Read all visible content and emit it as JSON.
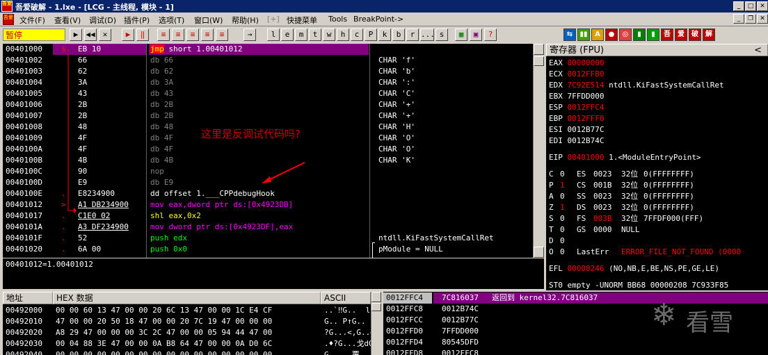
{
  "title": "吾爱破解 - 1.lxe - [LCG - 主线程, 模块 - 1]",
  "logo_text": "吾爱",
  "menu": [
    "文件(F)",
    "查看(V)",
    "调试(D)",
    "插件(P)",
    "选项(T)",
    "窗口(W)",
    "帮助(H)",
    "[+]",
    "快捷菜单",
    "Tools",
    "BreakPoint->"
  ],
  "status": "暂停",
  "toolbar_left": [
    "▶",
    "◀◀",
    "✕",
    "▶",
    "‖",
    "≡",
    "≡",
    "≡",
    "≡",
    "≡",
    "▶",
    "→"
  ],
  "toolbar_letters": [
    "l",
    "e",
    "m",
    "t",
    "w",
    "h",
    "c",
    "P",
    "k",
    "b",
    "r",
    "...",
    "s"
  ],
  "toolbar_right": [
    "⇆",
    "▮▮",
    "A",
    "●",
    "◎",
    "▮",
    "▮",
    "吾",
    "爱",
    "破",
    "解"
  ],
  "disasm": [
    {
      "addr": "00401000",
      "mark": "$.",
      "hex": "EB 10",
      "asm": "jmp short 1.00401012",
      "com": "",
      "sel": true
    },
    {
      "addr": "00401002",
      "mark": "",
      "hex": "66",
      "asm": "db 66",
      "com": "CHAR 'f'"
    },
    {
      "addr": "00401003",
      "mark": "",
      "hex": "62",
      "asm": "db 62",
      "com": "CHAR 'b'"
    },
    {
      "addr": "00401004",
      "mark": "",
      "hex": "3A",
      "asm": "db 3A",
      "com": "CHAR ':'"
    },
    {
      "addr": "00401005",
      "mark": "",
      "hex": "43",
      "asm": "db 43",
      "com": "CHAR 'C'"
    },
    {
      "addr": "00401006",
      "mark": "",
      "hex": "2B",
      "asm": "db 2B",
      "com": "CHAR '+'"
    },
    {
      "addr": "00401007",
      "mark": "",
      "hex": "2B",
      "asm": "db 2B",
      "com": "CHAR '+'"
    },
    {
      "addr": "00401008",
      "mark": "",
      "hex": "48",
      "asm": "db 48",
      "com": "CHAR 'H'"
    },
    {
      "addr": "00401009",
      "mark": "",
      "hex": "4F",
      "asm": "db 4F",
      "com": "CHAR 'O'"
    },
    {
      "addr": "0040100A",
      "mark": "",
      "hex": "4F",
      "asm": "db 4F",
      "com": "CHAR 'O'"
    },
    {
      "addr": "0040100B",
      "mark": "",
      "hex": "4B",
      "asm": "db 4B",
      "com": "CHAR 'K'"
    },
    {
      "addr": "0040100C",
      "mark": "",
      "hex": "90",
      "asm": "nop",
      "com": ""
    },
    {
      "addr": "0040100D",
      "mark": "",
      "hex": "E9",
      "asm": "db E9",
      "com": ""
    },
    {
      "addr": "0040100E",
      "mark": ".",
      "hex": "E8234900",
      "asm": "dd offset 1.___CPPdebugHook",
      "com": ""
    },
    {
      "addr": "00401012",
      "mark": ">",
      "hex": "A1 DB234900",
      "asm": "mov eax,dword ptr ds:[0x4923DB]",
      "com": ""
    },
    {
      "addr": "00401017",
      "mark": ".",
      "hex": "C1E0 02",
      "asm": "shl eax,0x2",
      "com": ""
    },
    {
      "addr": "0040101A",
      "mark": ".",
      "hex": "A3 DF234900",
      "asm": "mov dword ptr ds:[0x4923DF],eax",
      "com": ""
    },
    {
      "addr": "0040101F",
      "mark": ".",
      "hex": "52",
      "asm": "push edx",
      "com": "ntdll.KiFastSystemCallRet"
    },
    {
      "addr": "00401020",
      "mark": ".",
      "hex": "6A 00",
      "asm": "push 0x0",
      "com": "pModule = NULL"
    }
  ],
  "info_line": "00401012=1.00401012",
  "annotation": "这里是反调试代码吗?",
  "registers": {
    "header": "寄存器 (FPU)",
    "collapse": "<",
    "gp": [
      {
        "name": "EAX",
        "val": "00000000",
        "red": true,
        "com": ""
      },
      {
        "name": "ECX",
        "val": "0012FFB0",
        "red": true,
        "com": ""
      },
      {
        "name": "EDX",
        "val": "7C92E514",
        "red": true,
        "com": "ntdll.KiFastSystemCallRet"
      },
      {
        "name": "EBX",
        "val": "7FFDD000",
        "red": false,
        "com": ""
      },
      {
        "name": "ESP",
        "val": "0012FFC4",
        "red": true,
        "com": ""
      },
      {
        "name": "EBP",
        "val": "0012FFF0",
        "red": true,
        "com": ""
      },
      {
        "name": "ESI",
        "val": "0012B77C",
        "red": false,
        "com": ""
      },
      {
        "name": "EDI",
        "val": "0012B74C",
        "red": false,
        "com": ""
      }
    ],
    "eip": {
      "name": "EIP",
      "val": "00401000",
      "com": "1.<ModuleEntryPoint>"
    },
    "flags": [
      {
        "f": "C",
        "v": "0",
        "seg": "ES",
        "sv": "0023",
        "bits": "32位",
        "rest": "0(FFFFFFFF)",
        "vred": false,
        "svred": false
      },
      {
        "f": "P",
        "v": "1",
        "seg": "CS",
        "sv": "001B",
        "bits": "32位",
        "rest": "0(FFFFFFFF)",
        "vred": true,
        "svred": false
      },
      {
        "f": "A",
        "v": "0",
        "seg": "SS",
        "sv": "0023",
        "bits": "32位",
        "rest": "0(FFFFFFFF)",
        "vred": false,
        "svred": false
      },
      {
        "f": "Z",
        "v": "1",
        "seg": "DS",
        "sv": "0023",
        "bits": "32位",
        "rest": "0(FFFFFFFF)",
        "vred": true,
        "svred": false
      },
      {
        "f": "S",
        "v": "0",
        "seg": "FS",
        "sv": "003B",
        "bits": "32位",
        "rest": "7FFDF000(FFF)",
        "vred": false,
        "svred": true
      },
      {
        "f": "T",
        "v": "0",
        "seg": "GS",
        "sv": "0000",
        "bits": "",
        "rest": "NULL",
        "vred": false,
        "svred": false
      },
      {
        "f": "D",
        "v": "0",
        "seg": "",
        "sv": "",
        "bits": "",
        "rest": "",
        "vred": false,
        "svred": false
      },
      {
        "f": "O",
        "v": "0",
        "seg": "LastErr",
        "sv": "ERROR_FILE_NOT_FOUND (0000",
        "bits": "",
        "rest": "",
        "vred": false,
        "svred": true
      }
    ],
    "efl": {
      "name": "EFL",
      "val": "00000246",
      "com": "(NO,NB,E,BE,NS,PE,GE,LE)"
    },
    "st0": "ST0 empty -UNORM BB68 00000208 7C933F85"
  },
  "dump": {
    "h_addr": "地址",
    "h_hex": "HEX 数据",
    "h_ascii": "ASCII",
    "rows": [
      {
        "addr": "00492000",
        "hex": "00 00 60 13 47 00 00 20 6C 13 47 00 00 1C E4 CF",
        "ascii": "..`‼G..  l‼G..∟淦"
      },
      {
        "addr": "00492010",
        "hex": "47 00 00 20 50 18 47 00 00 20 7C 19 47 00 00 00",
        "ascii": "G.. P↑G.. |↓G..."
      },
      {
        "addr": "00492020",
        "hex": "A8 29 47 00 00 00 3C 2C 47 00 00 05 94 44 47 00",
        "ascii": "?G...<,G..♣擠G."
      },
      {
        "addr": "00492030",
        "hex": "00 04 88 3E 47 00 00 0A B8 64 47 00 00 0A D0 6C",
        "ascii": ".♦?G...戈dG...衛"
      },
      {
        "addr": "00492040",
        "hex": "00 00 00 00 00 00 00 00 00 00 00 00 00 00 00 00",
        "ascii": "G.....覆"
      }
    ]
  },
  "stack": [
    {
      "addr": "0012FFC4",
      "val": "7C816037",
      "com": "返回到 kernel32.7C816037",
      "sel": true
    },
    {
      "addr": "0012FFC8",
      "val": "0012B74C",
      "com": ""
    },
    {
      "addr": "0012FFCC",
      "val": "0012B77C",
      "com": ""
    },
    {
      "addr": "0012FFD0",
      "val": "7FFDD000",
      "com": ""
    },
    {
      "addr": "0012FFD4",
      "val": "80545DFD",
      "com": ""
    },
    {
      "addr": "0012FFD8",
      "val": "0012FFC8",
      "com": ""
    }
  ],
  "watermark": "看雪",
  "colors": {
    "selection": "#800080",
    "red": "#ff0000",
    "highlight": "#ffff00",
    "status_bg": "#ffff00"
  }
}
